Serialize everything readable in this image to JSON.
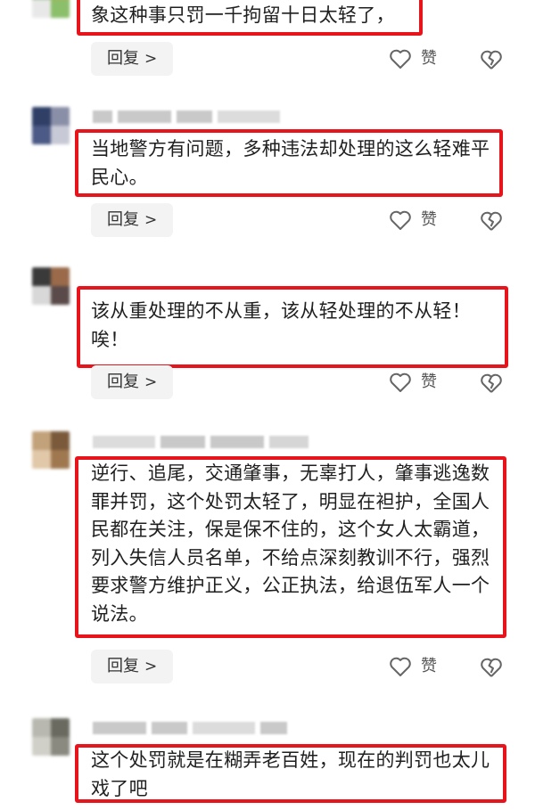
{
  "accent_color": "#e8141c",
  "comments": [
    {
      "text": "象这种事只罚一千拘留十日太轻了，",
      "reply_label": "回复",
      "like_label": "赞",
      "avatar_colors": [
        "#6aa84f",
        "#d9a441",
        "#e8e8e8",
        "#8bbf6a"
      ]
    },
    {
      "text": "当地警方有问题，多种违法却处理的这么轻难平民心。",
      "reply_label": "回复",
      "like_label": "赞",
      "avatar_colors": [
        "#2f3f66",
        "#8a8fa8",
        "#4b5a86",
        "#c7c9d6"
      ]
    },
    {
      "text": "该从重处理的不从重，该从轻处理的不从轻！唉！",
      "reply_label": "回复",
      "like_label": "赞",
      "avatar_colors": [
        "#3a3a3a",
        "#9a6a4a",
        "#d8d8d8",
        "#5a4a4a"
      ]
    },
    {
      "text": "逆行、追尾，交通肇事，无辜打人，肇事逃逸数罪并罚，这个处罚太轻了，明显在袒护，全国人民都在关注，保是保不住的，这个女人太霸道，列入失信人员名单，不给点深刻教训不行，强烈要求警方维护正义，公正执法，给退伍军人一个说法。",
      "reply_label": "回复",
      "like_label": "赞",
      "avatar_colors": [
        "#c2a27a",
        "#7a5a3a",
        "#e0c8a8",
        "#a07850"
      ]
    },
    {
      "text": "这个处罚就是在糊弄老百姓，现在的判罚也太儿戏了吧",
      "avatar_colors": [
        "#b8b8b0",
        "#6a6a60",
        "#d0d0c8",
        "#8a8a80"
      ]
    }
  ]
}
